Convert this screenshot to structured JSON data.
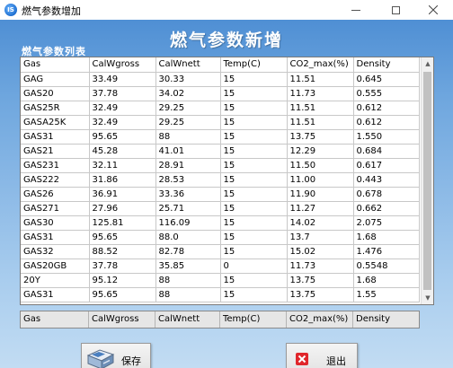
{
  "window": {
    "title": "燃气参数增加",
    "app_icon_text": "IS"
  },
  "header": {
    "title": "燃气参数新增",
    "list_title": "燃气参数列表"
  },
  "table": {
    "columns": [
      "Gas",
      "CalWgross",
      "CalWnett",
      "Temp(C)",
      "CO2_max(%)",
      "Density"
    ],
    "rows": [
      [
        "Gas",
        "CalWgross",
        "CalWnett",
        "Temp(C)",
        "CO2_max(%)",
        "Density"
      ],
      [
        "GAG",
        "33.49",
        "30.33",
        "15",
        "11.51",
        "0.645"
      ],
      [
        "GAS20",
        "37.78",
        "34.02",
        "15",
        "11.73",
        "0.555"
      ],
      [
        "GAS25R",
        "32.49",
        "29.25",
        "15",
        "11.51",
        "0.612"
      ],
      [
        "GASA25K",
        "32.49",
        "29.25",
        "15",
        "11.51",
        "0.612"
      ],
      [
        "GAS31",
        "95.65",
        "88",
        "15",
        "13.75",
        "1.550"
      ],
      [
        "GAS21",
        "45.28",
        "41.01",
        "15",
        "12.29",
        "0.684"
      ],
      [
        "GAS231",
        "32.11",
        "28.91",
        "15",
        "11.50",
        "0.617"
      ],
      [
        "GAS222",
        "31.86",
        "28.53",
        "15",
        "11.00",
        "0.443"
      ],
      [
        "GAS26",
        "36.91",
        "33.36",
        "15",
        "11.90",
        "0.678"
      ],
      [
        "GAS271",
        "27.96",
        "25.71",
        "15",
        "11.27",
        "0.662"
      ],
      [
        "GAS30",
        "125.81",
        "116.09",
        "15",
        "14.02",
        "2.075"
      ],
      [
        "GAS31",
        "95.65",
        "88.0",
        "15",
        "13.7",
        "1.68"
      ],
      [
        "GAS32",
        "88.52",
        "82.78",
        "15",
        "15.02",
        "1.476"
      ],
      [
        "GAS20GB",
        "37.78",
        "35.85",
        "0",
        "11.73",
        "0.5548"
      ],
      [
        "20Y",
        "95.12",
        "88",
        "15",
        "13.75",
        "1.68"
      ],
      [
        "GAS31",
        "95.65",
        "88",
        "15",
        "13.75",
        "1.55"
      ]
    ]
  },
  "input_row": {
    "fields": [
      "Gas",
      "CalWgross",
      "CalWnett",
      "Temp(C)",
      "CO2_max(%)",
      "Density"
    ]
  },
  "buttons": {
    "save_label": "保存",
    "exit_label": "退出"
  },
  "colors": {
    "panel_top": "#4f8fd4",
    "panel_bottom": "#c2dcf3",
    "exit_icon_red": "#e0262b"
  }
}
